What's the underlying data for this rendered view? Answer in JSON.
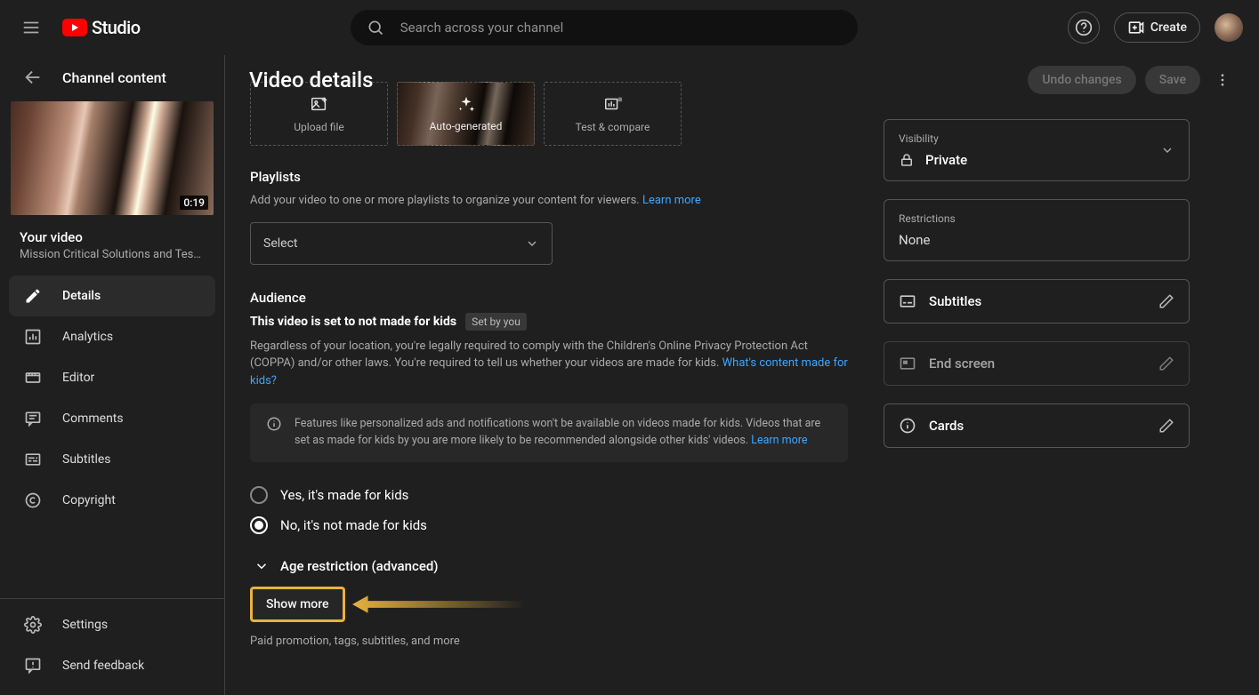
{
  "header": {
    "brand": "Studio",
    "search_placeholder": "Search across your channel",
    "create_label": "Create"
  },
  "sidebar": {
    "back_title": "Channel content",
    "thumb_time": "0:19",
    "your_video_label": "Your video",
    "video_title": "Mission Critical Solutions and TestR…",
    "nav": [
      {
        "label": "Details"
      },
      {
        "label": "Analytics"
      },
      {
        "label": "Editor"
      },
      {
        "label": "Comments"
      },
      {
        "label": "Subtitles"
      },
      {
        "label": "Copyright"
      }
    ],
    "settings_label": "Settings",
    "feedback_label": "Send feedback"
  },
  "page": {
    "title": "Video details",
    "undo_label": "Undo changes",
    "save_label": "Save"
  },
  "thumbs": {
    "upload": "Upload file",
    "auto": "Auto-generated",
    "test": "Test & compare"
  },
  "playlists": {
    "title": "Playlists",
    "desc": "Add your video to one or more playlists to organize your content for viewers. ",
    "learn_more": "Learn more",
    "select": "Select"
  },
  "audience": {
    "title": "Audience",
    "status": "This video is set to not made for kids",
    "chip": "Set by you",
    "desc": "Regardless of your location, you're legally required to comply with the Children's Online Privacy Protection Act (COPPA) and/or other laws. You're required to tell us whether your videos are made for kids. ",
    "desc_link": "What's content made for kids?",
    "info": "Features like personalized ads and notifications won't be available on videos made for kids. Videos that are set as made for kids by you are more likely to be recommended alongside other kids' videos. ",
    "info_link": "Learn more",
    "opt_yes": "Yes, it's made for kids",
    "opt_no": "No, it's not made for kids",
    "age_restriction": "Age restriction (advanced)"
  },
  "more": {
    "button": "Show more",
    "sub": "Paid promotion, tags, subtitles, and more"
  },
  "rail": {
    "visibility_label": "Visibility",
    "visibility_value": "Private",
    "restrictions_label": "Restrictions",
    "restrictions_value": "None",
    "subtitles": "Subtitles",
    "end_screen": "End screen",
    "cards": "Cards"
  }
}
